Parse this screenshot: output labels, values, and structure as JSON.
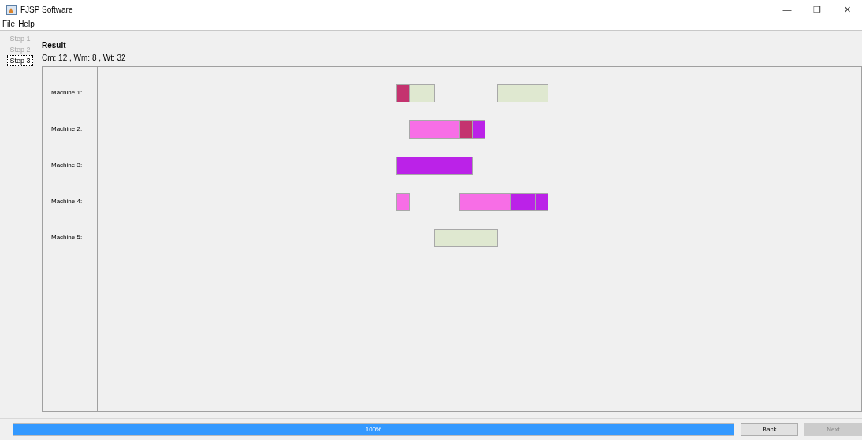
{
  "window": {
    "title": "FJSP Software",
    "controls": [
      "—",
      "❐",
      "✕"
    ]
  },
  "menu": [
    "File",
    "Help"
  ],
  "steps": [
    {
      "label": "Step 1",
      "selected": false,
      "disabled": true
    },
    {
      "label": "Step 2",
      "selected": false,
      "disabled": true
    },
    {
      "label": "Step 3",
      "selected": true,
      "disabled": false
    }
  ],
  "result": {
    "title": "Result",
    "summary": "Cm: 12 , Wm: 8 , Wt: 32"
  },
  "machines": [
    {
      "label": "Machine 1:",
      "tasks": [
        {
          "color": "#c4336f"
        },
        {
          "color": "#dfe8d0"
        },
        {
          "color": "#dfe8d0"
        }
      ]
    },
    {
      "label": "Machine 2:",
      "tasks": [
        {
          "color": "#f76ee6"
        },
        {
          "color": "#c4336f"
        },
        {
          "color": "#bb22e8"
        }
      ]
    },
    {
      "label": "Machine 3:",
      "tasks": [
        {
          "color": "#bb22e8"
        }
      ]
    },
    {
      "label": "Machine 4:",
      "tasks": [
        {
          "color": "#f76ee6"
        },
        {
          "color": "#f76ee6"
        },
        {
          "color": "#bb22e8"
        },
        {
          "color": "#bb22e8"
        }
      ]
    },
    {
      "label": "Machine 5:",
      "tasks": [
        {
          "color": "#dfe8d0"
        }
      ]
    }
  ],
  "progress": {
    "level": 1,
    "text": "100%"
  },
  "buttons": [
    {
      "label": "Back",
      "disabled": false
    },
    {
      "label": "Next",
      "disabled": true
    }
  ]
}
